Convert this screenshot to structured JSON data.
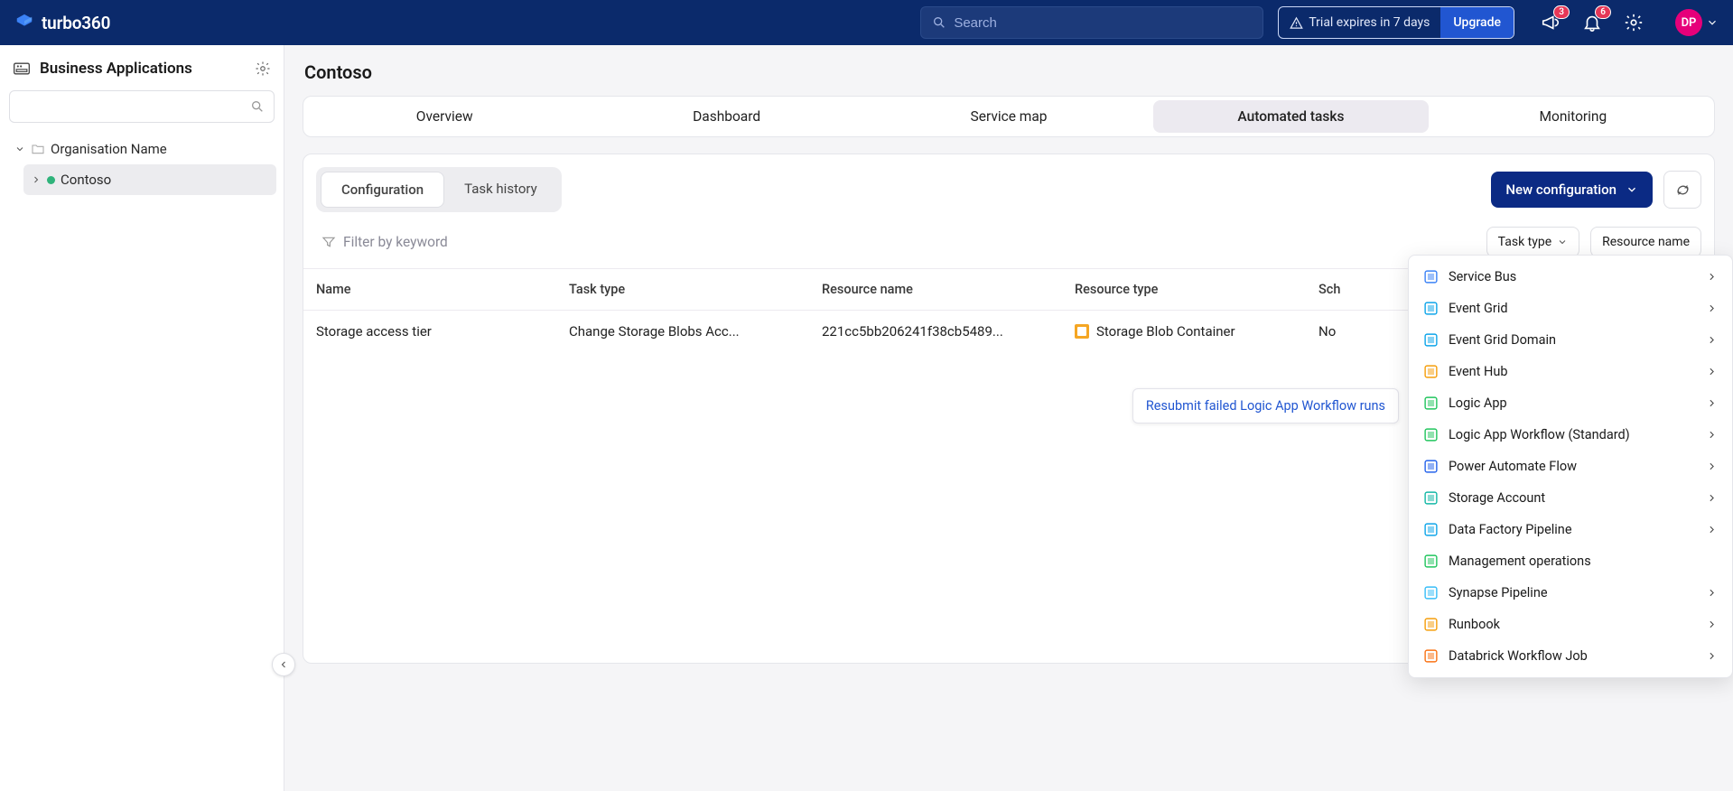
{
  "brand": "turbo360",
  "search": {
    "placeholder": "Search"
  },
  "trial": {
    "text": "Trial expires in 7 days",
    "cta": "Upgrade"
  },
  "badges": {
    "announce": "3",
    "notify": "6"
  },
  "avatar": "DP",
  "sidebar": {
    "title": "Business Applications",
    "org": "Organisation Name",
    "child": "Contoso"
  },
  "page": {
    "title": "Contoso"
  },
  "tabs": [
    {
      "label": "Overview"
    },
    {
      "label": "Dashboard"
    },
    {
      "label": "Service map"
    },
    {
      "label": "Automated tasks"
    },
    {
      "label": "Monitoring"
    }
  ],
  "subtabs": [
    {
      "label": "Configuration"
    },
    {
      "label": "Task history"
    }
  ],
  "actions": {
    "new_config": "New configuration"
  },
  "filter": {
    "placeholder": "Filter by keyword",
    "chips": [
      {
        "label": "Task type"
      },
      {
        "label": "Resource name"
      }
    ]
  },
  "columns": {
    "name": "Name",
    "task": "Task type",
    "res": "Resource name",
    "type": "Resource type",
    "sched": "Sch"
  },
  "rows": [
    {
      "name": "Storage access tier",
      "task": "Change Storage Blobs Acc...",
      "res": "221cc5bb206241f38cb5489...",
      "type": "Storage Blob Container",
      "sched": "No"
    }
  ],
  "hover_text": "Resubmit failed Logic App Workflow runs",
  "dropdown": [
    {
      "label": "Service Bus",
      "color": "#3b82f6"
    },
    {
      "label": "Event Grid",
      "color": "#0ea5e9"
    },
    {
      "label": "Event Grid Domain",
      "color": "#0ea5e9"
    },
    {
      "label": "Event Hub",
      "color": "#f59e0b"
    },
    {
      "label": "Logic App",
      "color": "#22c55e"
    },
    {
      "label": "Logic App Workflow (Standard)",
      "color": "#22c55e"
    },
    {
      "label": "Power Automate Flow",
      "color": "#2563eb"
    },
    {
      "label": "Storage Account",
      "color": "#14b8a6"
    },
    {
      "label": "Data Factory Pipeline",
      "color": "#0ea5e9"
    },
    {
      "label": "Management operations",
      "color": "#22c55e"
    },
    {
      "label": "Synapse Pipeline",
      "color": "#38bdf8"
    },
    {
      "label": "Runbook",
      "color": "#f59e0b"
    },
    {
      "label": "Databrick Workflow Job",
      "color": "#f97316"
    }
  ]
}
